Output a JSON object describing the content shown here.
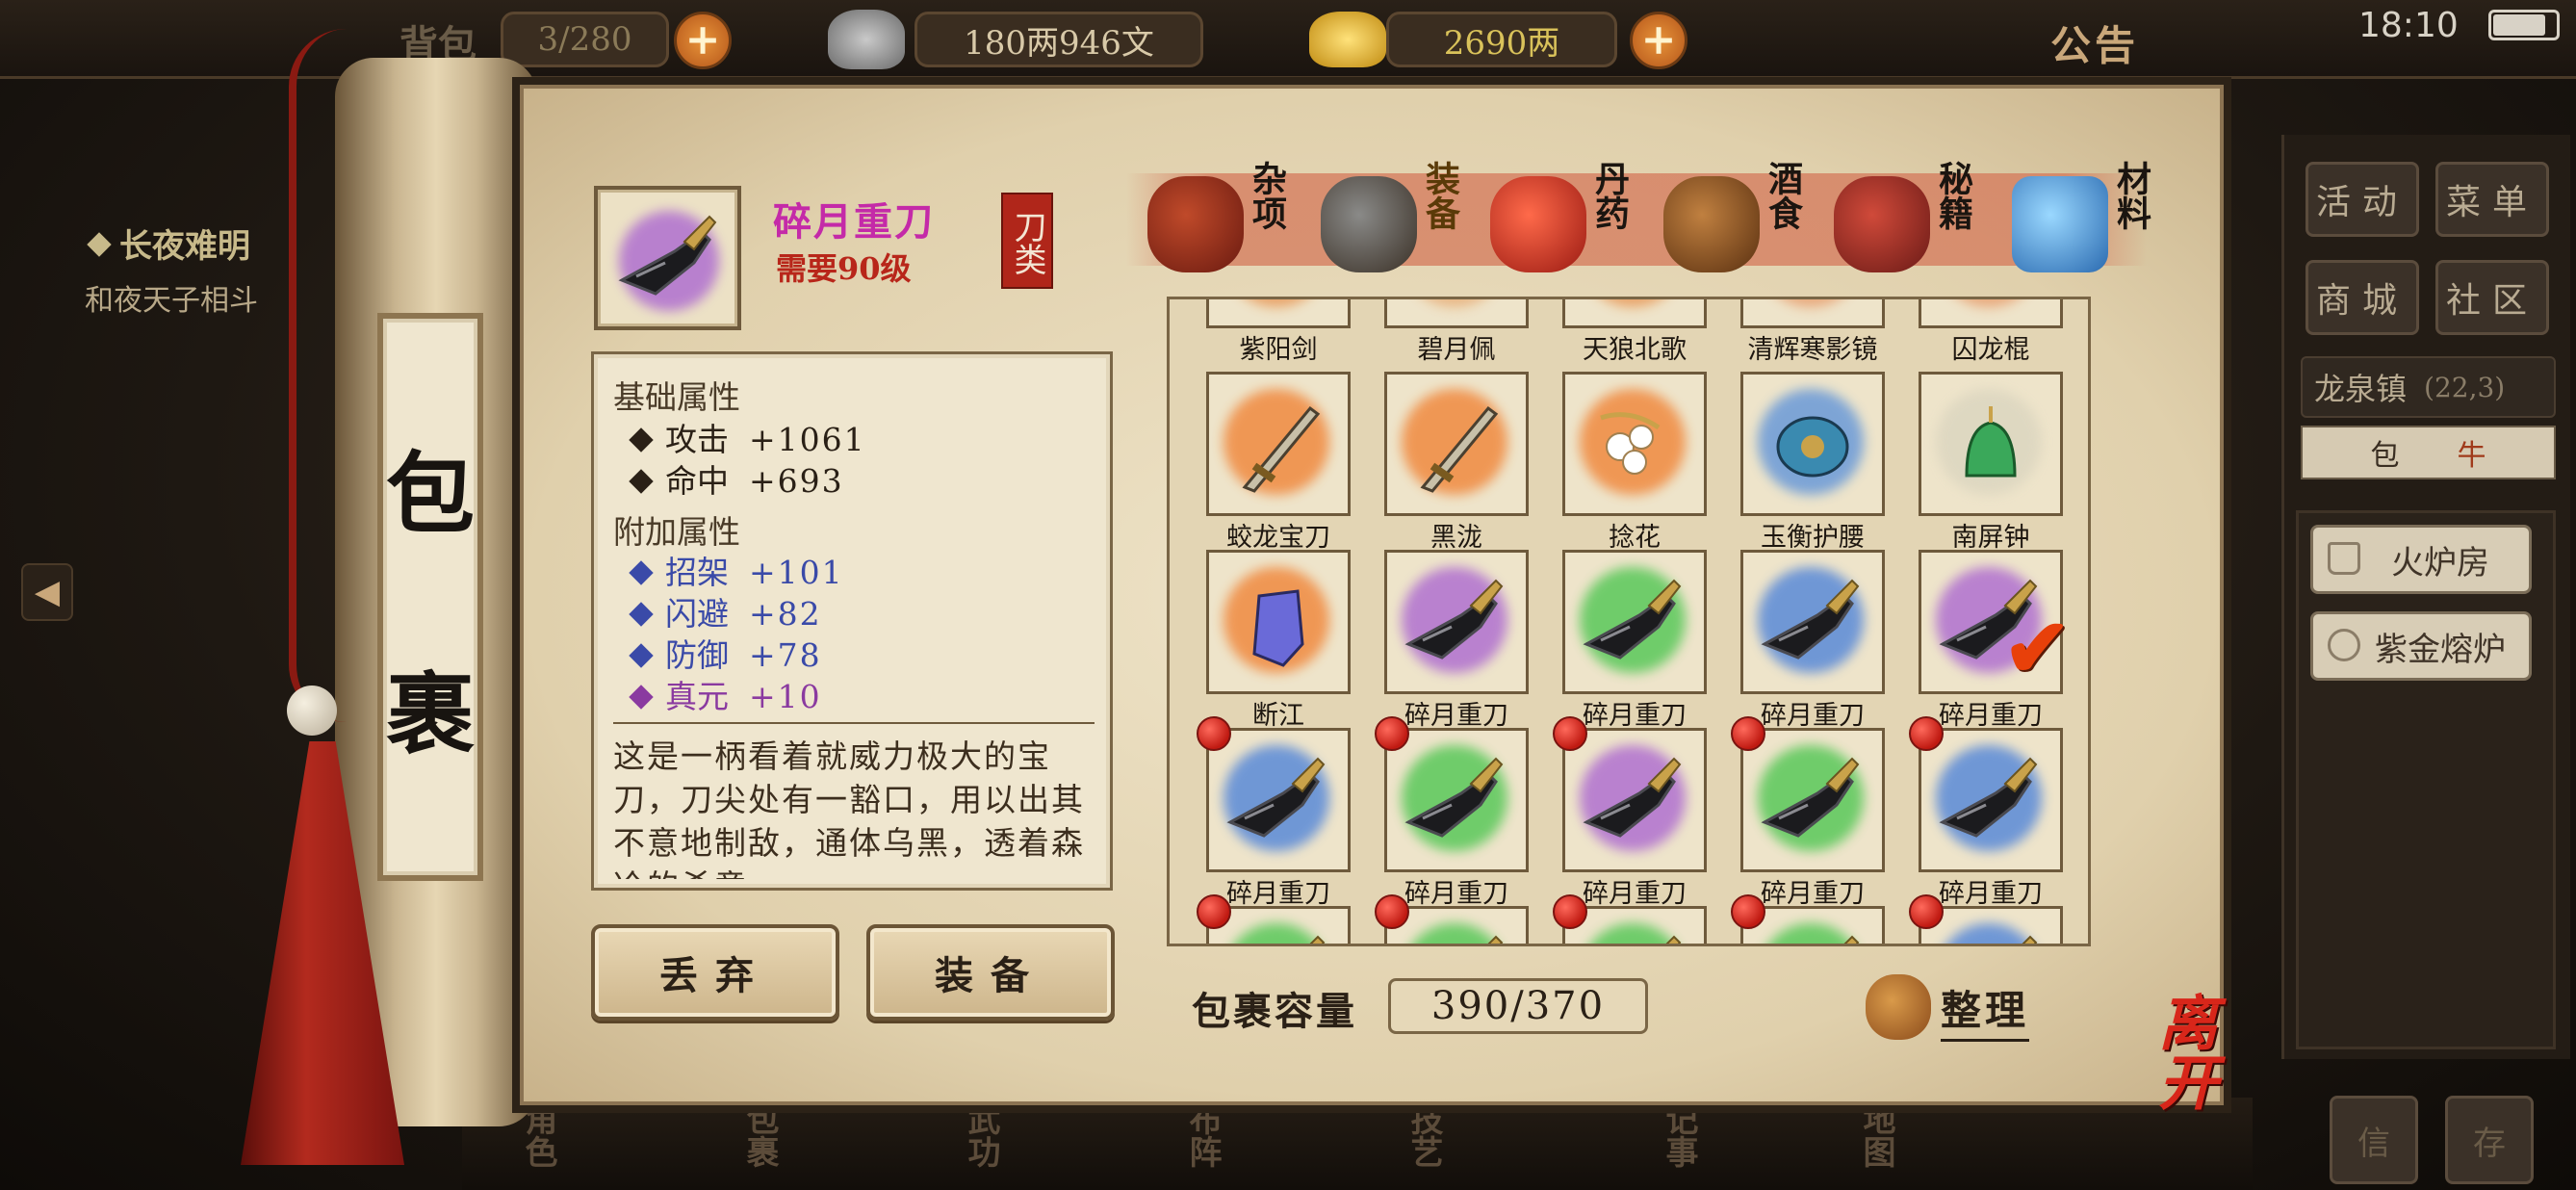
{
  "topbar": {
    "bag_label": "背包",
    "bag_count": "3/280",
    "silver": "180两946文",
    "gold": "2690两",
    "notice": "公告",
    "time": "18:10"
  },
  "quest": {
    "title": "长夜难明",
    "subtitle": "和夜天子相斗"
  },
  "scroll_title": [
    "包",
    "裹"
  ],
  "selected_item": {
    "name": "碎月重刀",
    "level_req": "需要90级",
    "type_stamp": "刀类",
    "base_header": "基础属性",
    "base_attrs": [
      {
        "name": "攻击",
        "value": "+1061"
      },
      {
        "name": "命中",
        "value": "+693"
      }
    ],
    "extra_header": "附加属性",
    "extra_attrs": [
      {
        "name": "招架",
        "value": "+101",
        "color": "#3a4aa8"
      },
      {
        "name": "闪避",
        "value": "+82",
        "color": "#3a4aa8"
      },
      {
        "name": "防御",
        "value": "+78",
        "color": "#3a4aa8"
      },
      {
        "name": "真元",
        "value": "+10",
        "color": "#8a3aa0"
      }
    ],
    "description": "这是一柄看着就威力极大的宝刀，刀尖处有一豁口，用以出其不意地制敌，通体乌黑，透着森冷的杀意"
  },
  "actions": {
    "discard": "丢弃",
    "equip": "装备"
  },
  "tabs": [
    {
      "label": "杂项",
      "icon": "jar-icon",
      "color": "#8a2a1a",
      "active": false
    },
    {
      "label": "装备",
      "icon": "equipment-icon",
      "color": "#5a4a3a",
      "active": true
    },
    {
      "label": "丹药",
      "icon": "pills-icon",
      "color": "#c43a2a",
      "active": false
    },
    {
      "label": "酒食",
      "icon": "food-icon",
      "color": "#7a4a22",
      "active": false
    },
    {
      "label": "秘籍",
      "icon": "book-icon",
      "color": "#9a2a2a",
      "active": false
    },
    {
      "label": "材料",
      "icon": "crystal-icon",
      "color": "#4a9ad8",
      "active": false
    }
  ],
  "grid_rows": [
    [
      {
        "name": "紫阳剑",
        "glow": "#e89a5a"
      },
      {
        "name": "碧月佩",
        "glow": "#e8b07a"
      },
      {
        "name": "天狼北歌",
        "glow": "#e89a5a"
      },
      {
        "name": "清辉寒影镜",
        "glow": "#e8a070"
      },
      {
        "name": "囚龙棍",
        "glow": "#e8a070"
      }
    ],
    [
      {
        "name": "蛟龙宝刀",
        "glow": "#f08a40",
        "icon": "sword-icon"
      },
      {
        "name": "黑泷",
        "glow": "#f08a40",
        "icon": "sword-icon"
      },
      {
        "name": "捻花",
        "glow": "#f08a40",
        "icon": "flower-ornament-icon"
      },
      {
        "name": "玉衡护腰",
        "glow": "#6a9ad8",
        "icon": "belt-icon"
      },
      {
        "name": "南屏钟",
        "glow": "#dcd6c0",
        "icon": "bell-icon"
      }
    ],
    [
      {
        "name": "断江",
        "glow": "#f08a40",
        "icon": "gauntlet-icon"
      },
      {
        "name": "碎月重刀",
        "glow": "#b070d0",
        "icon": "blade-icon"
      },
      {
        "name": "碎月重刀",
        "glow": "#5ac85a",
        "icon": "blade-icon"
      },
      {
        "name": "碎月重刀",
        "glow": "#5a8ad8",
        "icon": "blade-icon"
      },
      {
        "name": "碎月重刀",
        "glow": "#b070d0",
        "icon": "blade-icon",
        "selected": true
      }
    ],
    [
      {
        "name": "碎月重刀",
        "glow": "#5a8ad8",
        "icon": "blade-icon",
        "new": true
      },
      {
        "name": "碎月重刀",
        "glow": "#5ac85a",
        "icon": "blade-icon",
        "new": true
      },
      {
        "name": "碎月重刀",
        "glow": "#b070d0",
        "icon": "blade-icon",
        "new": true
      },
      {
        "name": "碎月重刀",
        "glow": "#5ac85a",
        "icon": "blade-icon",
        "new": true
      },
      {
        "name": "碎月重刀",
        "glow": "#5a8ad8",
        "icon": "blade-icon",
        "new": true
      }
    ],
    [
      {
        "name": "",
        "glow": "#5ac85a",
        "new": true
      },
      {
        "name": "",
        "glow": "#5ac85a",
        "new": true
      },
      {
        "name": "",
        "glow": "#5ac85a",
        "new": true
      },
      {
        "name": "",
        "glow": "#5ac85a",
        "new": true
      },
      {
        "name": "",
        "glow": "#5a8ad8",
        "new": true
      }
    ]
  ],
  "capacity": {
    "label": "包裹容量",
    "value": "390/370",
    "sort": "整理"
  },
  "leave": "离开",
  "right_panel": {
    "buttons": [
      "活动",
      "菜单",
      "商城",
      "社区"
    ],
    "location_name": "龙泉镇",
    "location_coord": "(22,3)",
    "minimap_text": [
      "包",
      "牛"
    ],
    "functions": [
      "火炉房",
      "紫金熔炉"
    ]
  },
  "bottom_nav": [
    "角色",
    "包裹",
    "武功",
    "布阵",
    "技艺",
    "记事",
    "地图"
  ],
  "bottom_right": [
    "信",
    "存"
  ]
}
